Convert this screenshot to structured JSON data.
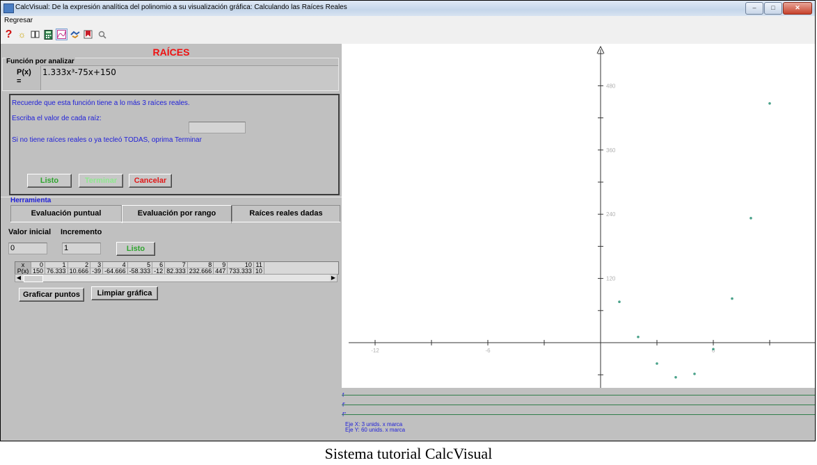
{
  "window": {
    "title": "CalcVisual: De la expresión analítica del polinomio a su visualización gráfica: Calculando las Raíces Reales",
    "controls": {
      "minimize": "–",
      "maximize": "□",
      "close": "✕"
    }
  },
  "menu": {
    "items": [
      {
        "label": "Regresar"
      }
    ]
  },
  "toolbar": {
    "icons": [
      "help-icon",
      "lightbulb-icon",
      "book-icon",
      "calculator-icon",
      "graph-icon",
      "handshake-icon",
      "bookmark-icon",
      "magnifier-icon"
    ]
  },
  "roots_panel": {
    "heading": "RAÍCES",
    "function_legend": "Función por analizar",
    "p_label": "P(x)",
    "equals": "=",
    "polynomial": "1.333x³-75x+150",
    "reminder": "Recuerde que esta función tiene a lo más 3 raíces reales.",
    "prompt": "Escriba el valor de cada raíz:",
    "root_value": "",
    "hint": "Si no tiene raíces reales o ya tecleó TODAS, oprima Terminar",
    "buttons": {
      "ok": "Listo",
      "finish": "Terminar",
      "cancel": "Cancelar"
    }
  },
  "tools": {
    "label": "Herramienta",
    "tabs": [
      {
        "label": "Evaluación puntual",
        "active": false
      },
      {
        "label": "Evaluación por rango",
        "active": true
      },
      {
        "label": "Raíces reales dadas",
        "active": false
      }
    ],
    "initial_value_label": "Valor inicial",
    "increment_label": "Incremento",
    "initial_value": "0",
    "increment": "1",
    "ok_button": "Listo",
    "table": {
      "row_x_label": "x",
      "row_p_label": "P(x)",
      "x": [
        "0",
        "1",
        "2",
        "3",
        "4",
        "5",
        "6",
        "7",
        "8",
        "9",
        "10",
        "11"
      ],
      "p": [
        "150",
        "76.333",
        "10.666",
        "-39",
        "-64.666",
        "-58.333",
        "-12",
        "82.333",
        "232.666",
        "447",
        "733.333",
        "10"
      ]
    },
    "plot_button": "Graficar puntos",
    "clear_button": "Limpiar gráfica"
  },
  "graph": {
    "x_ticks": [
      {
        "value": -12,
        "label": "-12"
      },
      {
        "value": -6,
        "label": "-6"
      },
      {
        "value": 6,
        "label": "6"
      }
    ],
    "y_ticks": [
      {
        "value": 480,
        "label": "480"
      },
      {
        "value": 360,
        "label": "360"
      },
      {
        "value": 240,
        "label": "240"
      },
      {
        "value": 120,
        "label": "120"
      }
    ],
    "points": [
      {
        "x": 1,
        "y": 76.333
      },
      {
        "x": 2,
        "y": 10.666
      },
      {
        "x": 3,
        "y": -39
      },
      {
        "x": 4,
        "y": -64.666
      },
      {
        "x": 5,
        "y": -58.333
      },
      {
        "x": 6,
        "y": -12
      },
      {
        "x": 7,
        "y": 82.333
      },
      {
        "x": 8,
        "y": 232.666
      },
      {
        "x": 9,
        "y": 447
      }
    ],
    "x_scale_note": "Eje X: 3 unids. x marca",
    "y_scale_note": "Eje Y: 60 unids. x marca",
    "deriv_labels": [
      "f",
      "f'",
      "f''"
    ],
    "point_color": "#4aa28a",
    "axis_color": "#333333"
  },
  "caption": "Sistema tutorial CalcVisual"
}
